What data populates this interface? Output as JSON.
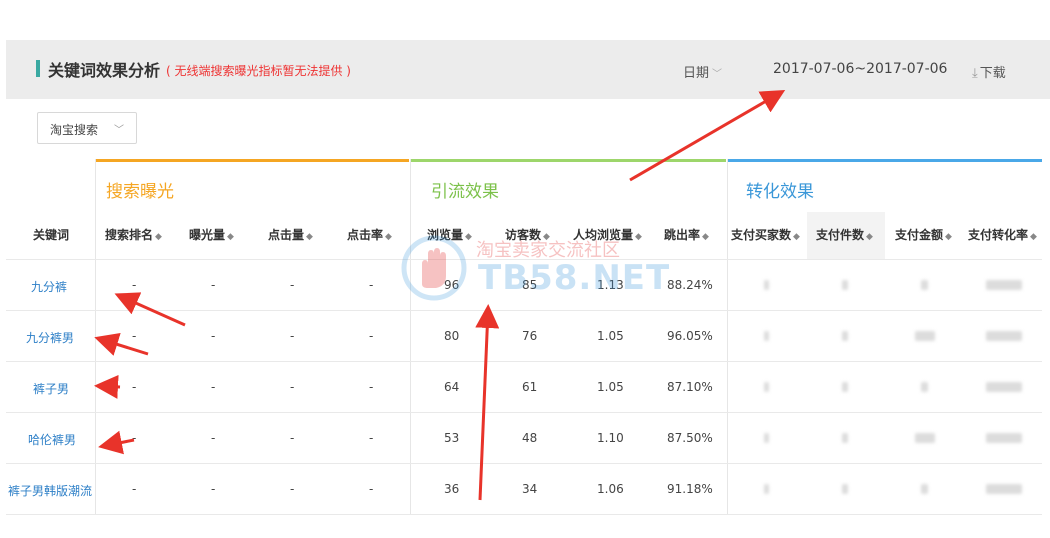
{
  "header": {
    "title": "关键词效果分析",
    "note": "( 无线端搜索曝光指标暂无法提供 )",
    "date_label": "日期",
    "date_range": "2017-07-06~2017-07-06",
    "download_label": "下载"
  },
  "source_select": {
    "value": "淘宝搜索"
  },
  "groups": {
    "search": "搜索曝光",
    "traffic": "引流效果",
    "conversion": "转化效果"
  },
  "columns": {
    "keyword": "关键词",
    "rank": "搜索排名",
    "exposure": "曝光量",
    "clicks": "点击量",
    "ctr": "点击率",
    "pv": "浏览量",
    "uv": "访客数",
    "pv_per_uv": "人均浏览量",
    "bounce": "跳出率",
    "buyers": "支付买家数",
    "items": "支付件数",
    "amount": "支付金额",
    "cvr": "支付转化率"
  },
  "rows": [
    {
      "keyword": "九分裤",
      "rank": "-",
      "exposure": "-",
      "clicks": "-",
      "ctr": "-",
      "pv": "96",
      "uv": "85",
      "pv_per_uv": "1.13",
      "bounce": "88.24%"
    },
    {
      "keyword": "九分裤男",
      "rank": "-",
      "exposure": "-",
      "clicks": "-",
      "ctr": "-",
      "pv": "80",
      "uv": "76",
      "pv_per_uv": "1.05",
      "bounce": "96.05%"
    },
    {
      "keyword": "裤子男",
      "rank": "-",
      "exposure": "-",
      "clicks": "-",
      "ctr": "-",
      "pv": "64",
      "uv": "61",
      "pv_per_uv": "1.05",
      "bounce": "87.10%"
    },
    {
      "keyword": "哈伦裤男",
      "rank": "-",
      "exposure": "-",
      "clicks": "-",
      "ctr": "-",
      "pv": "53",
      "uv": "48",
      "pv_per_uv": "1.10",
      "bounce": "87.50%"
    },
    {
      "keyword": "裤子男韩版潮流",
      "rank": "-",
      "exposure": "-",
      "clicks": "-",
      "ctr": "-",
      "pv": "36",
      "uv": "34",
      "pv_per_uv": "1.06",
      "bounce": "91.18%"
    }
  ],
  "watermark": {
    "cn": "淘宝卖家交流社区",
    "en": "TB58.NET"
  },
  "colors": {
    "search_group": "#f5a623",
    "traffic_group": "#7cc14a",
    "conversion_group": "#3a97d8",
    "keyword_link": "#2d7fc7",
    "note_red": "#e33333",
    "annotation_arrow": "#e8332a"
  },
  "icons": {
    "dropdown": "chevron-down-icon",
    "download": "download-icon",
    "sort": "sort-icon"
  }
}
